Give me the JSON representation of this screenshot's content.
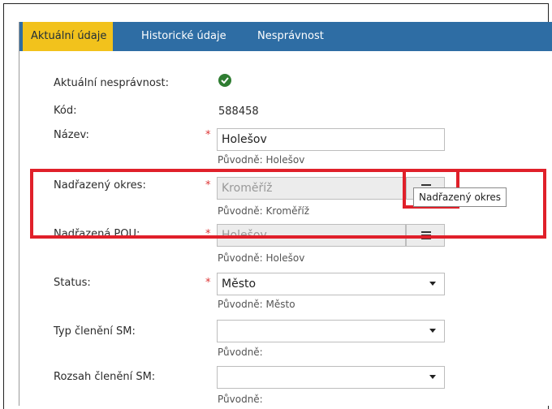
{
  "tabs": [
    {
      "label": "Aktuální údaje",
      "active": true
    },
    {
      "label": "Historické údaje",
      "active": false
    },
    {
      "label": "Nesprávnost",
      "active": false
    }
  ],
  "fields": {
    "nespravnost": {
      "label": "Aktuální nesprávnost:",
      "status_icon": "check-circle-icon"
    },
    "kod": {
      "label": "Kód:",
      "value": "588458"
    },
    "nazev": {
      "label": "Název:",
      "required": "*",
      "value": "Holešov",
      "original": "Původně: Holešov"
    },
    "okres": {
      "label": "Nadřazený okres:",
      "required": "*",
      "value": "Kroměříž",
      "original": "Původně: Kroměříž",
      "button_icon": "list-icon",
      "tooltip": "Nadřazený okres"
    },
    "pou": {
      "label": "Nadřazená POU:",
      "required": "*",
      "value": "Holešov",
      "original": "Původně: Holešov",
      "button_icon": "list-icon"
    },
    "status": {
      "label": "Status:",
      "required": "*",
      "value": "Město",
      "original": "Původně: Město"
    },
    "typ": {
      "label": "Typ členění SM:",
      "value": "",
      "original": "Původně:"
    },
    "rozsah": {
      "label": "Rozsah členění SM:",
      "value": "",
      "original": "Původně:"
    }
  },
  "colors": {
    "tabbar": "#2e6da4",
    "active_tab": "#f2c21c",
    "highlight": "#e0202a",
    "required": "#dd3333",
    "ok": "#2f7d32"
  }
}
